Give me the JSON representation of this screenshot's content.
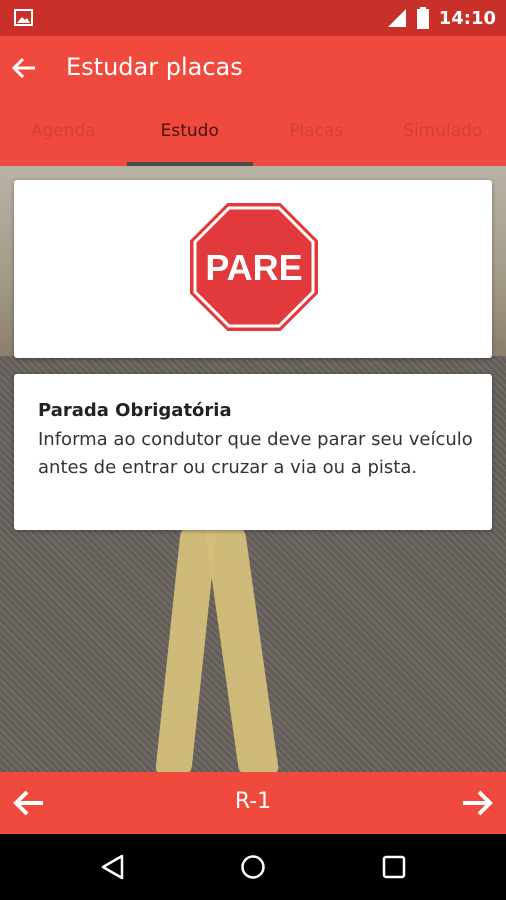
{
  "status_bar": {
    "time": "14:10",
    "icons": [
      "image-icon",
      "signal-icon",
      "battery-icon"
    ]
  },
  "app_bar": {
    "title": "Estudar placas",
    "back_icon": "arrow-left-icon"
  },
  "tabs": [
    {
      "label": "Agenda",
      "active": false
    },
    {
      "label": "Estudo",
      "active": true
    },
    {
      "label": "Placas",
      "active": false
    },
    {
      "label": "Simulado",
      "active": false
    }
  ],
  "sign": {
    "text": "PARE",
    "icon": "stop-sign-icon"
  },
  "info": {
    "name": "Parada Obrigatória",
    "description": "Informa ao condutor que deve parar seu veículo antes de entrar ou cruzar a via ou a pista."
  },
  "bottom_bar": {
    "code": "R-1",
    "prev_icon": "arrow-left-icon",
    "next_icon": "arrow-right-icon"
  },
  "nav": {
    "back_icon": "nav-back-icon",
    "home_icon": "nav-home-icon",
    "recents_icon": "nav-recents-icon"
  },
  "colors": {
    "primary": "#f0493d",
    "status": "#c9302a",
    "sign_red": "#e1393c"
  }
}
